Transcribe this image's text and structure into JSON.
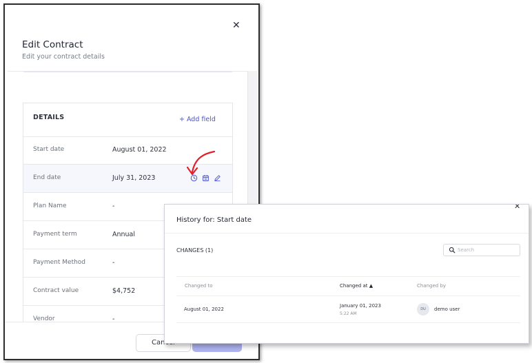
{
  "panel": {
    "title": "Edit Contract",
    "subtitle": "Edit your contract details",
    "close_icon": "close-icon"
  },
  "details": {
    "header": "DETAILS",
    "add_field": "+ Add field",
    "rows": [
      {
        "label": "Start date",
        "value": "August 01, 2022"
      },
      {
        "label": "End date",
        "value": "July 31, 2023"
      },
      {
        "label": "Plan Name",
        "value": "-"
      },
      {
        "label": "Payment term",
        "value": "Annual"
      },
      {
        "label": "Payment Method",
        "value": "-"
      },
      {
        "label": "Contract value",
        "value": "$4,752"
      },
      {
        "label": "Vendor",
        "value": "-"
      }
    ],
    "row_icons": [
      "history-icon",
      "calendar-icon",
      "edit-pencil-icon"
    ]
  },
  "footer": {
    "cancel_label": "Cancel",
    "save_label": ""
  },
  "history": {
    "title": "History for: Start date",
    "changes_label": "CHANGES (1)",
    "search_placeholder": "Search",
    "columns": {
      "changed_to": "Changed to",
      "changed_at": "Changed at ▲",
      "changed_by": "Changed by"
    },
    "entries": [
      {
        "changed_to": "August 01, 2022",
        "changed_at_date": "January 01, 2023",
        "changed_at_time": "5:22 AM",
        "avatar_initials": "DU",
        "changed_by": "demo user"
      }
    ]
  },
  "colors": {
    "accent": "#4b53d6",
    "save_button": "#aeb2ef",
    "annotation_arrow": "#e0202a",
    "highlight_row": "#f6f7fd"
  }
}
